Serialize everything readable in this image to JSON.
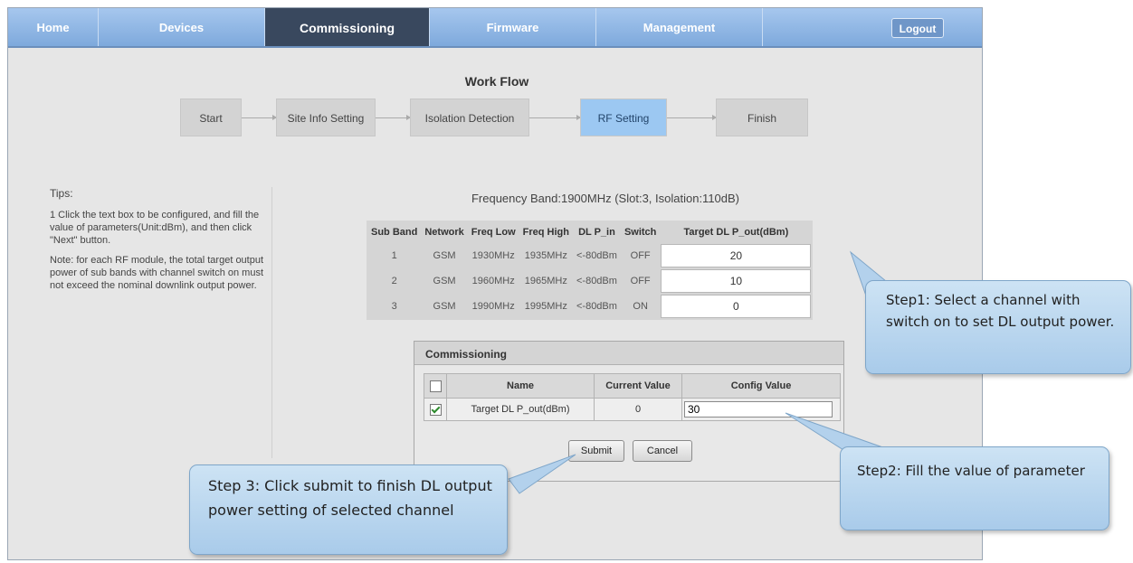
{
  "nav": {
    "tabs": [
      {
        "label": "Home",
        "active": false
      },
      {
        "label": "Devices",
        "active": false
      },
      {
        "label": "Commissioning",
        "active": true
      },
      {
        "label": "Firmware",
        "active": false
      },
      {
        "label": "Management",
        "active": false
      }
    ],
    "logout_label": "Logout"
  },
  "workflow": {
    "title": "Work Flow",
    "steps": [
      "Start",
      "Site Info Setting",
      "Isolation Detection",
      "RF Setting",
      "Finish"
    ],
    "active_step": "RF Setting"
  },
  "tips": {
    "title": "Tips:",
    "paragraph1": "1 Click the text box to be configured, and fill the value of parameters(Unit:dBm), and then click \"Next\" button.",
    "paragraph2": "Note: for each RF module, the total target output power of sub bands with channel switch on must not exceed the nominal downlink output power."
  },
  "rf": {
    "header_text": "Frequency Band:1900MHz  (Slot:3, Isolation:110dB)",
    "columns": [
      "Sub Band",
      "Network",
      "Freq Low",
      "Freq High",
      "DL P_in",
      "Switch",
      "Target DL P_out(dBm)"
    ],
    "rows": [
      {
        "sub_band": "1",
        "network": "GSM",
        "freq_low": "1930MHz",
        "freq_high": "1935MHz",
        "dl_p_in": "<-80dBm",
        "switch": "OFF",
        "target": "20"
      },
      {
        "sub_band": "2",
        "network": "GSM",
        "freq_low": "1960MHz",
        "freq_high": "1965MHz",
        "dl_p_in": "<-80dBm",
        "switch": "OFF",
        "target": "10"
      },
      {
        "sub_band": "3",
        "network": "GSM",
        "freq_low": "1990MHz",
        "freq_high": "1995MHz",
        "dl_p_in": "<-80dBm",
        "switch": "ON",
        "target": "0"
      }
    ]
  },
  "modal": {
    "title": "Commissioning",
    "columns": [
      "Name",
      "Current Value",
      "Config Value"
    ],
    "row": {
      "checked": true,
      "name": "Target DL P_out(dBm)",
      "current": "0",
      "config": "30"
    },
    "header_checked": false,
    "submit_label": "Submit",
    "cancel_label": "Cancel"
  },
  "callouts": {
    "step1": "Step1: Select a channel with switch on to set DL output power.",
    "step2": "Step2: Fill the value of parameter",
    "step3": "Step 3: Click submit to finish DL output power setting of selected channel"
  },
  "colors": {
    "nav_bg": "#8fb5e4",
    "active_tab": "#39485e",
    "active_step": "#9cc8f2",
    "callout_bg": "#b9d6ef"
  }
}
